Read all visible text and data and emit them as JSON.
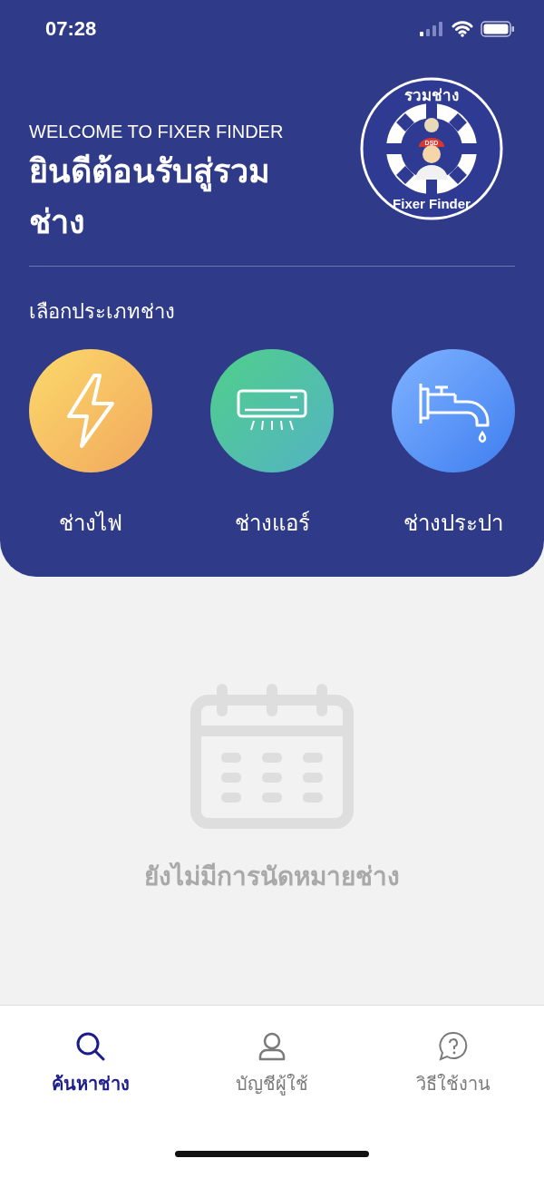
{
  "status_bar": {
    "time": "07:28"
  },
  "header": {
    "welcome": "WELCOME TO FIXER FINDER",
    "title": "ยินดีต้อนรับสู่รวมช่าง",
    "logo": {
      "top_text": "รวมช่าง",
      "badge_text": "DSD",
      "bottom_text": "Fixer Finder"
    }
  },
  "categories": {
    "heading": "เลือกประเภทช่าง",
    "items": [
      {
        "kind": "electric",
        "label": "ช่างไฟ"
      },
      {
        "kind": "aircon",
        "label": "ช่างแอร์"
      },
      {
        "kind": "plumbing",
        "label": "ช่างประปา"
      }
    ]
  },
  "empty_state": {
    "message": "ยังไม่มีการนัดหมายช่าง"
  },
  "tab_bar": [
    {
      "kind": "search",
      "label": "ค้นหาช่าง",
      "selected": true
    },
    {
      "kind": "user",
      "label": "บัญชีผู้ใช้",
      "selected": false
    },
    {
      "kind": "help",
      "label": "วิธีใช้งาน",
      "selected": false
    }
  ]
}
